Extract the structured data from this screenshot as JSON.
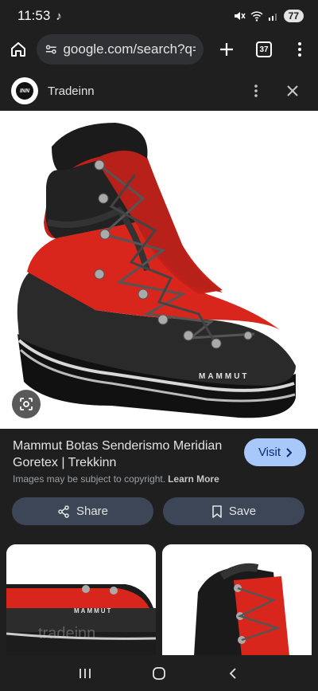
{
  "status": {
    "time": "11:53",
    "battery": "77"
  },
  "browser": {
    "url": "google.com/search?q=n",
    "tab_count": "37"
  },
  "source": {
    "name": "Tradeinn",
    "logo_text": "INN"
  },
  "result": {
    "title": "Mammut Botas Senderismo Meridian Goretex | Trekkinn",
    "visit_label": "Visit",
    "copyright_text": "Images may be subject to copyright.",
    "learn_more": "Learn More"
  },
  "actions": {
    "share_label": "Share",
    "save_label": "Save"
  },
  "image": {
    "brand": "MAMMUT",
    "thumb_brand": "MAMMUT",
    "watermark": "tradeinn"
  },
  "icons": [
    "home-icon",
    "site-settings-icon",
    "plus-icon",
    "tabs-icon",
    "more-vert-icon",
    "close-icon",
    "lens-icon",
    "share-icon",
    "bookmark-icon",
    "chevron-right-icon",
    "recents-icon",
    "home-circle-icon",
    "back-icon"
  ],
  "colors": {
    "accent": "#a8c7fa",
    "button_bg": "#3c4657",
    "boot_red": "#d9261c"
  }
}
